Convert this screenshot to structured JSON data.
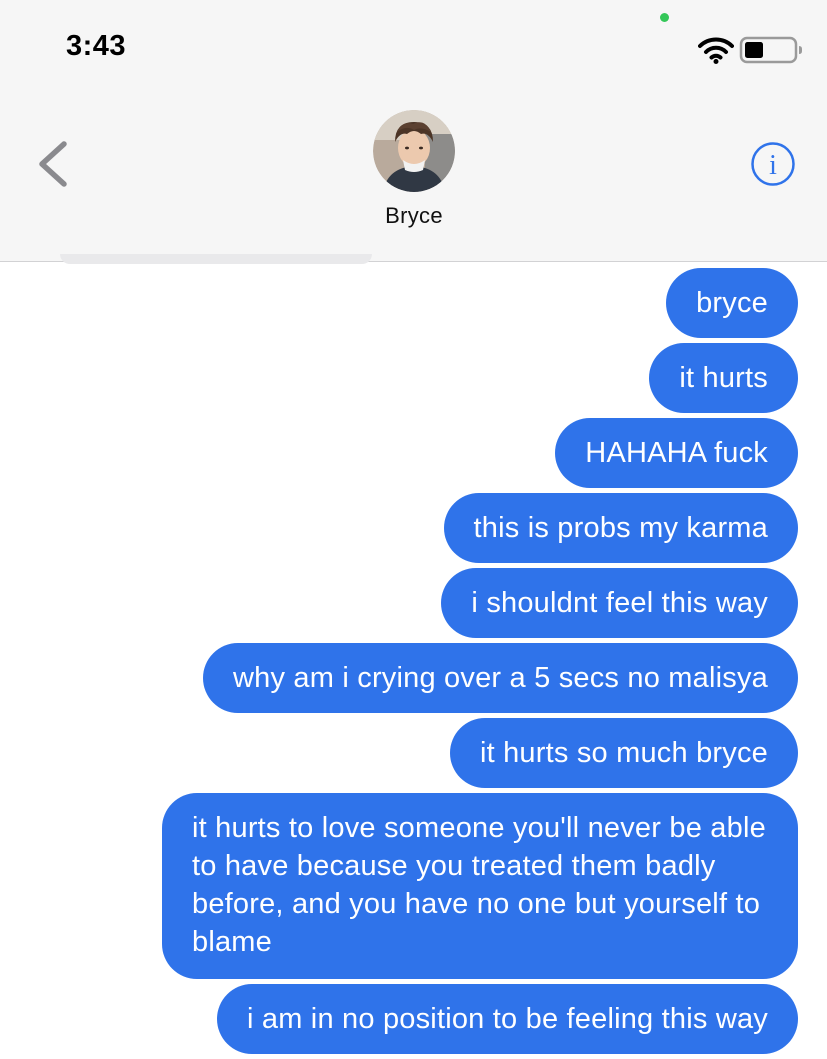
{
  "status_bar": {
    "time": "3:43",
    "icons": [
      "mic-indicator-dot",
      "wifi-icon",
      "battery-icon"
    ],
    "battery_level": 0.35
  },
  "header": {
    "back_icon": "chevron-left-icon",
    "contact_name": "Bryce",
    "info_icon": "info-circle-icon"
  },
  "colors": {
    "header_bg": "#f6f6f6",
    "sent_bubble": "#2f73ea",
    "received_bubble": "#e9e9eb",
    "accent": "#2f73ea"
  },
  "messages": [
    {
      "text": "bryce"
    },
    {
      "text": "it hurts"
    },
    {
      "text": "HAHAHA fuck"
    },
    {
      "text": "this is probs my karma"
    },
    {
      "text": "i shouldnt feel this way"
    },
    {
      "text": "why am i crying over a 5 secs no malisya"
    },
    {
      "text": "it hurts so much bryce"
    },
    {
      "text": "it hurts to love someone you'll never be able to have because you treated them badly before, and you have no one but yourself to blame"
    },
    {
      "text": "i am in no position to be feeling this way"
    }
  ]
}
